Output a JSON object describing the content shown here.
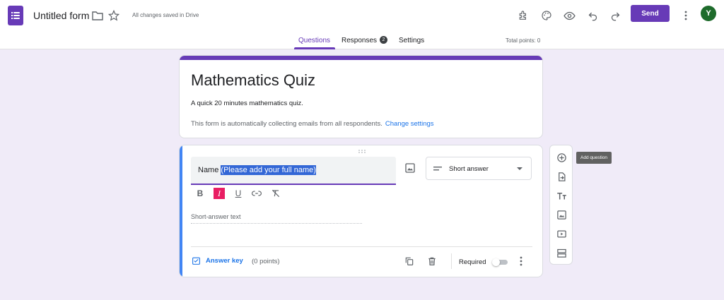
{
  "header": {
    "form_title": "Untitled form",
    "save_status": "All changes saved in Drive",
    "send_label": "Send",
    "avatar_initial": "Y",
    "total_points": "Total points: 0"
  },
  "tabs": [
    {
      "label": "Questions",
      "active": true
    },
    {
      "label": "Responses",
      "badge": "2"
    },
    {
      "label": "Settings"
    }
  ],
  "title_card": {
    "title": "Mathematics Quiz",
    "description": "A quick 20 minutes mathematics quiz.",
    "email_note": "This form is automatically collecting emails from all respondents.",
    "change_settings": "Change settings"
  },
  "question": {
    "label_plain": "Name",
    "label_selected": "(Please add your full name)",
    "type": "Short answer",
    "placeholder": "Short-answer text",
    "answer_key": "Answer key",
    "points": "(0 points)",
    "required_label": "Required",
    "required": false
  },
  "side_toolbar": {
    "tooltip": "Add question",
    "items": [
      "add-question",
      "import-questions",
      "add-title-description",
      "add-image",
      "add-video",
      "add-section"
    ]
  },
  "colors": {
    "accent": "#673ab7",
    "background": "#f0ebf8",
    "link": "#1a73e8",
    "active_question": "#4285f4",
    "italic_highlight": "#e91e63"
  }
}
